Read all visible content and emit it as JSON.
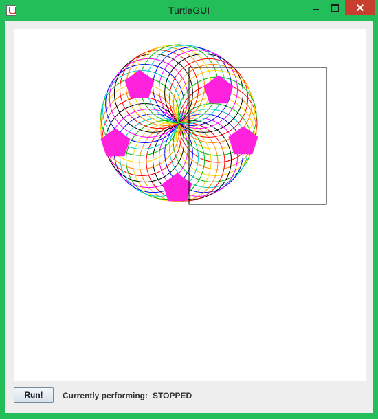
{
  "window": {
    "title": "TurtleGUI",
    "icon": "java-cup-icon",
    "controls": [
      "minimize-icon",
      "maximize-icon",
      "close-icon"
    ],
    "close_glyph": "✕"
  },
  "colors": {
    "frame": "#23be5a",
    "close": "#c7402f",
    "pentagon": "#ff22dd",
    "pen": "#000000",
    "rainbow": [
      "#ff0000",
      "#ff8800",
      "#ffd700",
      "#00bb00",
      "#00cccc",
      "#0000ff",
      "#ff00ff",
      "#000000"
    ]
  },
  "toolbar": {
    "run_label": "Run!",
    "status_label": "Currently performing:",
    "status_value": "STOPPED"
  }
}
